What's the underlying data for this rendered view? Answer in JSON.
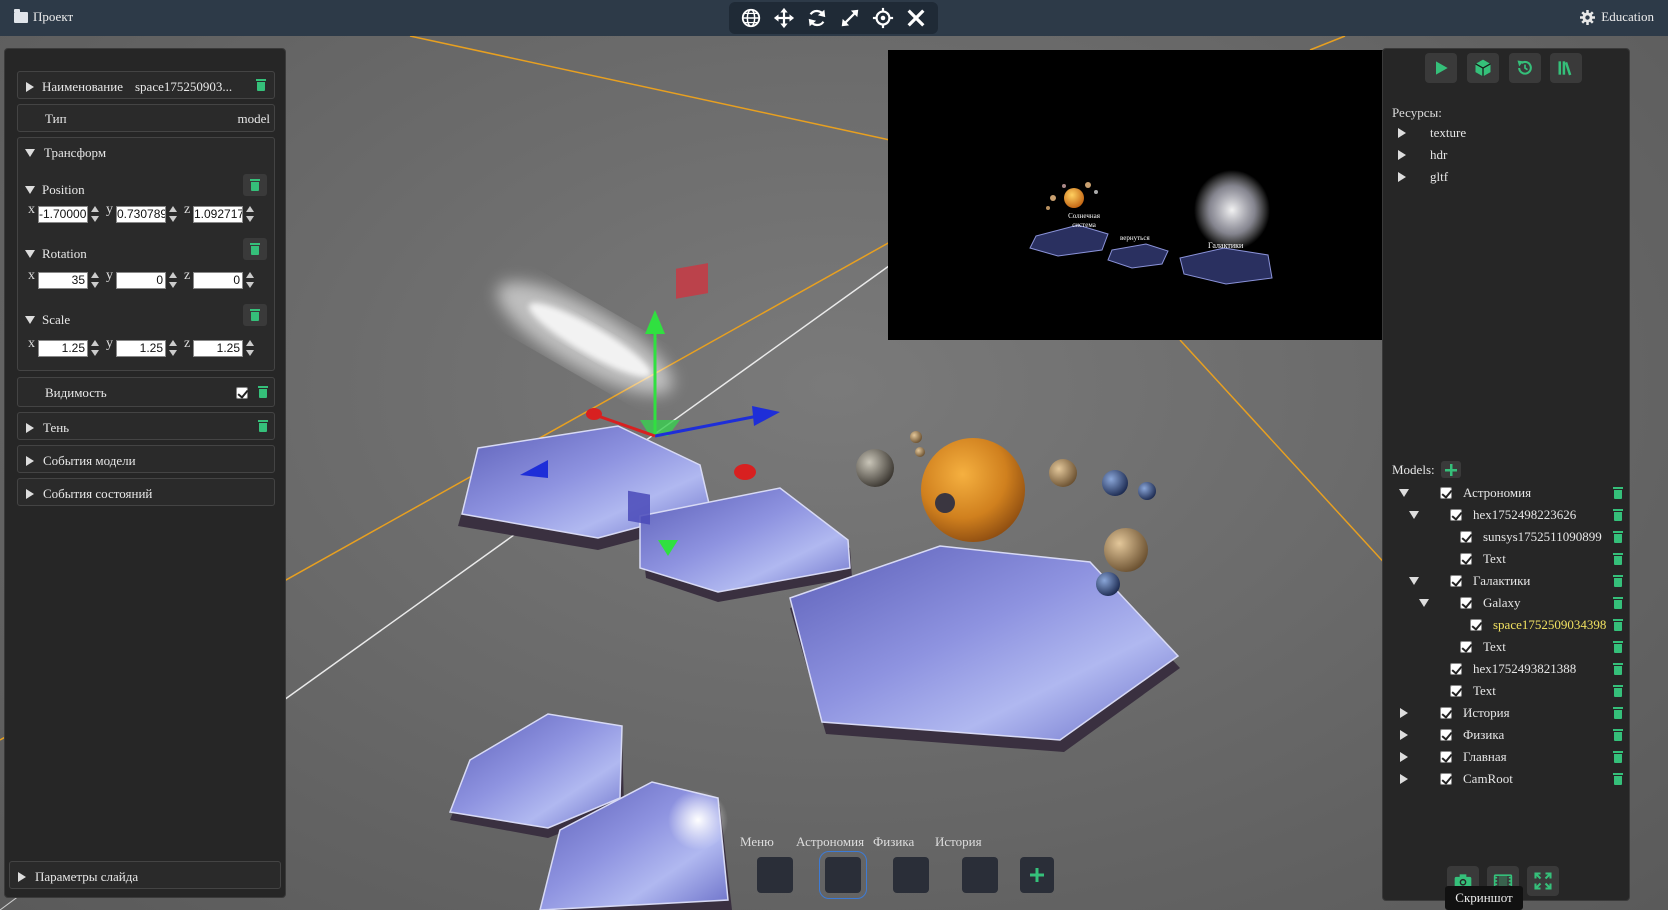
{
  "topbar": {
    "project_label": "Проект",
    "education_label": "Education",
    "tools": [
      "globe-icon",
      "move-icon",
      "rotate-icon",
      "scale-icon",
      "focus-icon",
      "close-icon"
    ]
  },
  "left": {
    "name_label": "Наименование",
    "name_value": "space175250903...",
    "type_label": "Тип",
    "type_value": "model",
    "transform_label": "Трансформ",
    "position_label": "Position",
    "position": {
      "x": "-1.70000",
      "y": "0.730789",
      "z": "1.092717"
    },
    "rotation_label": "Rotation",
    "rotation": {
      "x": "35",
      "y": "0",
      "z": "0"
    },
    "scale_label": "Scale",
    "scale": {
      "x": "1.25",
      "y": "1.25",
      "z": "1.25"
    },
    "axis_x": "x",
    "axis_y": "y",
    "axis_z": "z",
    "visibility_label": "Видимость",
    "shadow_label": "Тень",
    "model_events_label": "События модели",
    "state_events_label": "События состояний",
    "slide_params_label": "Параметры слайда"
  },
  "right": {
    "resources_label": "Ресурсы:",
    "resources": [
      "texture",
      "hdr",
      "gltf"
    ],
    "models_label": "Models:",
    "tree": [
      {
        "label": "Астрономия",
        "depth": 0,
        "arrow": "down"
      },
      {
        "label": "hex1752498223626",
        "depth": 1,
        "arrow": "down"
      },
      {
        "label": "sunsys1752511090899",
        "depth": 2,
        "arrow": "none"
      },
      {
        "label": "Text",
        "depth": 2,
        "arrow": "none"
      },
      {
        "label": "Галактики",
        "depth": 1,
        "arrow": "down"
      },
      {
        "label": "Galaxy",
        "depth": 2,
        "arrow": "down"
      },
      {
        "label": "space1752509034398",
        "depth": 3,
        "arrow": "none",
        "selected": true
      },
      {
        "label": "Text",
        "depth": 2,
        "arrow": "none"
      },
      {
        "label": "hex1752493821388",
        "depth": 1,
        "arrow": "none"
      },
      {
        "label": "Text",
        "depth": 1,
        "arrow": "none"
      },
      {
        "label": "История",
        "depth": 0,
        "arrow": "right"
      },
      {
        "label": "Физика",
        "depth": 0,
        "arrow": "right"
      },
      {
        "label": "Главная",
        "depth": 0,
        "arrow": "right"
      },
      {
        "label": "CamRoot",
        "depth": 0,
        "arrow": "right"
      }
    ],
    "tooltip": "Скриншот"
  },
  "preview": {
    "label_solar": "Солнечная система",
    "label_back": "вернуться",
    "label_galaxies": "Галактики"
  },
  "slides": {
    "items": [
      {
        "label": "Меню",
        "active": false
      },
      {
        "label": "Астрономия",
        "active": true
      },
      {
        "label": "Физика",
        "active": false
      },
      {
        "label": "История",
        "active": false
      }
    ]
  },
  "colors": {
    "accent_green": "#35c07a",
    "topbar": "#2d3a48",
    "panel": "#262626",
    "selected_text": "#f0e060"
  }
}
